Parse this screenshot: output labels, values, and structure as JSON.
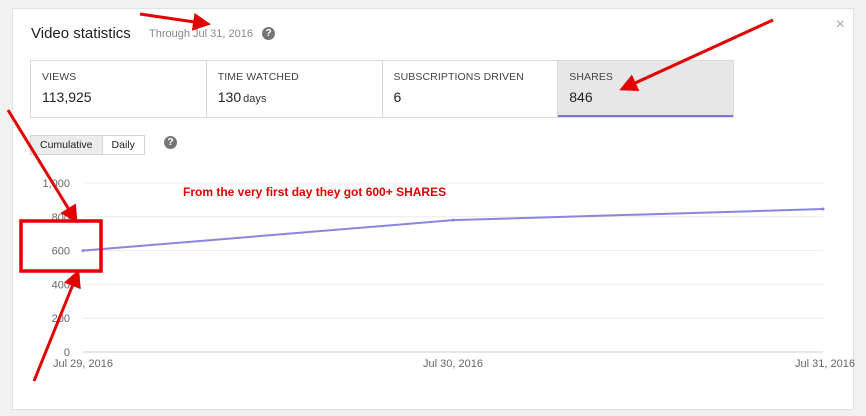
{
  "header": {
    "title": "Video statistics",
    "subtitle": "Through Jul 31, 2016"
  },
  "metrics": [
    {
      "label": "VIEWS",
      "value": "113,925",
      "unit": ""
    },
    {
      "label": "TIME WATCHED",
      "value": "130",
      "unit": "days"
    },
    {
      "label": "SUBSCRIPTIONS DRIVEN",
      "value": "6",
      "unit": ""
    },
    {
      "label": "SHARES",
      "value": "846",
      "unit": "",
      "selected": true
    }
  ],
  "toggle": {
    "cumulative": "Cumulative",
    "daily": "Daily",
    "selected": "Cumulative"
  },
  "help_icon_glyph": "?",
  "close_icon_glyph": "×",
  "annotation": "From the very first day they got 600+ SHARES",
  "colors": {
    "line": "#8b85e0",
    "annotation": "#e30000",
    "accent": "#7b73d8"
  },
  "icons": [
    "help-icon",
    "close-icon"
  ],
  "chart_data": {
    "type": "line",
    "x": [
      "Jul 29, 2016",
      "Jul 30, 2016",
      "Jul 31, 2016"
    ],
    "series": [
      {
        "values": [
          600,
          780,
          846
        ]
      }
    ],
    "yticks": [
      "0",
      "200",
      "400",
      "600",
      "800",
      "1,000"
    ],
    "ylim": [
      0,
      1000
    ],
    "grid": true
  }
}
